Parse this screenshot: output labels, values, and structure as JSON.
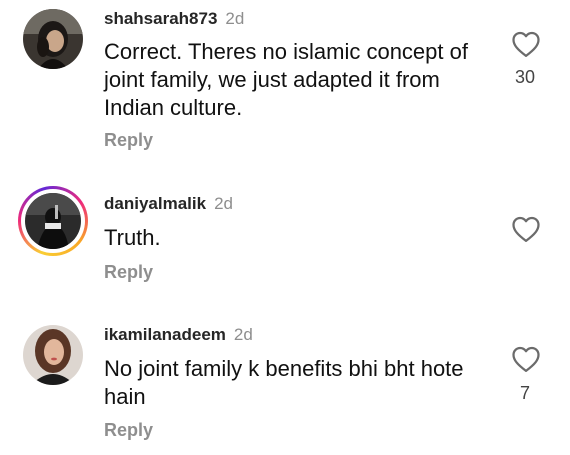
{
  "comments": [
    {
      "username": "shahsarah873",
      "time": "2d",
      "text": "Correct. Theres no islamic concept of joint family, we just adapted it from Indian culture.",
      "reply_label": "Reply",
      "like_count": "30",
      "has_story_ring": false,
      "like_icon": "heart-outline"
    },
    {
      "username": "daniyalmalik",
      "time": "2d",
      "text": "Truth.",
      "reply_label": "Reply",
      "like_count": "",
      "has_story_ring": true,
      "like_icon": "heart-outline"
    },
    {
      "username": "ikamilanadeem",
      "time": "2d",
      "text": "No joint family k benefits bhi bht hote hain",
      "reply_label": "Reply",
      "like_count": "7",
      "has_story_ring": false,
      "like_icon": "heart-outline"
    }
  ],
  "colors": {
    "muted": "#8e8e8e",
    "text": "#111111",
    "story_ring_start": "#f9ce34",
    "story_ring_mid": "#ee2a7b",
    "story_ring_end": "#6228d7"
  }
}
